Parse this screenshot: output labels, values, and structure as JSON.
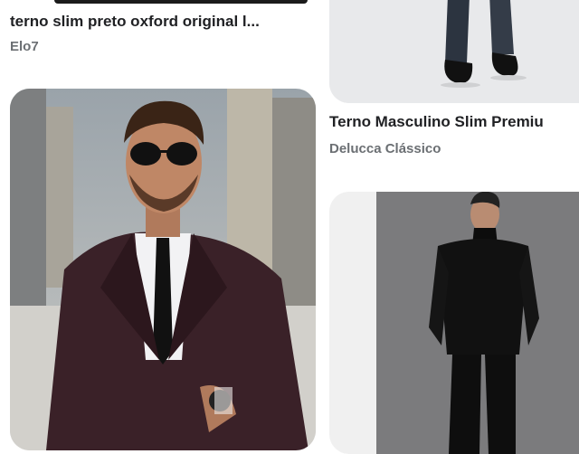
{
  "pins": [
    {
      "title": "terno slim preto oxford original l...",
      "source": "Elo7"
    },
    {
      "title": "Terno Masculino Slim Premiu",
      "source": "Delucca Clássico"
    },
    {
      "image": "man in burgundy suit with sunglasses on city street"
    },
    {
      "image": "man in black suit and black turtleneck on grey background"
    }
  ],
  "colors": {
    "title": "#202124",
    "source": "#6b6f73",
    "background": "#ffffff"
  }
}
